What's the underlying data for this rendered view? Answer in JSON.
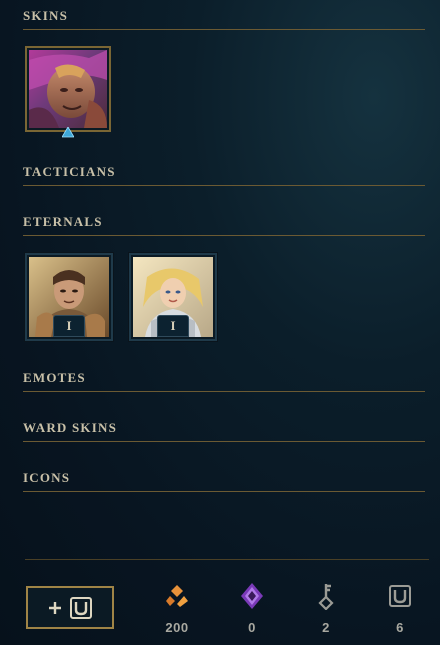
{
  "sections": {
    "skins": "SKINS",
    "tacticians": "TACTICIANS",
    "eternals": "ETERNALS",
    "emotes": "EMOTES",
    "ward_skins": "WARD SKINS",
    "icons": "ICONS"
  },
  "skins": [
    {
      "icon": "champion-skin-portrait",
      "marker": "blue-gem-icon"
    }
  ],
  "eternals": [
    {
      "icon": "eternal-champion-portrait",
      "level": "I"
    },
    {
      "icon": "eternal-champion-portrait",
      "level": "I"
    }
  ],
  "footer": {
    "unlock_button_icon": "plus-chest-icon",
    "currencies": [
      {
        "icon": "orange-essence-icon",
        "value": "200",
        "color": "#e8923a"
      },
      {
        "icon": "mythic-essence-icon",
        "value": "0",
        "color": "#a466e0"
      },
      {
        "icon": "key-fragment-icon",
        "value": "2",
        "color": "#9b9b95"
      },
      {
        "icon": "chest-icon",
        "value": "6",
        "color": "#9b9b95"
      }
    ]
  },
  "colors": {
    "background": "#081521",
    "section_title": "#c8c0a8",
    "divider": "#6b5a33",
    "gold_border": "#9f8446"
  }
}
